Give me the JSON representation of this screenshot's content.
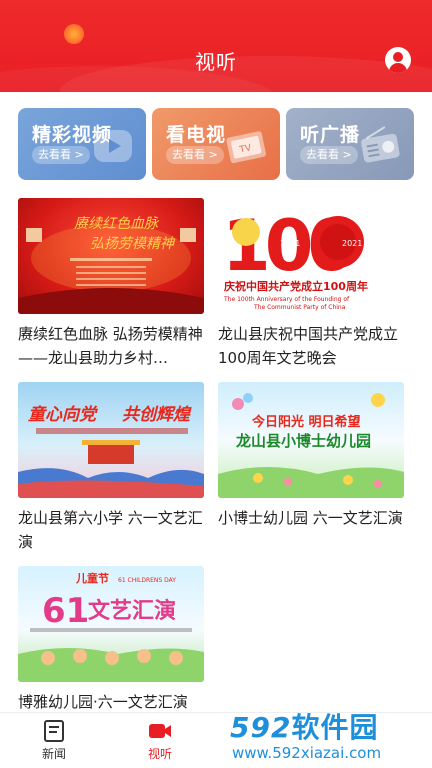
{
  "header": {
    "title": "视听"
  },
  "categories": [
    {
      "name": "精彩视频",
      "more": "去看看 >"
    },
    {
      "name": "看电视",
      "more": "去看看 >",
      "icon_text": "TV"
    },
    {
      "name": "听广播",
      "more": "去看看 >"
    }
  ],
  "videos": [
    {
      "caption": "赓续红色血脉 弘扬劳模精神 ——龙山县助力乡村…",
      "thumb_text": {
        "line1": "赓续红色血脉",
        "line2": "弘扬劳模精神"
      }
    },
    {
      "caption": "龙山县庆祝中国共产党成立100周年文艺晚会",
      "thumb_text": {
        "big": "100",
        "year_left": "1921",
        "year_right": "2021",
        "cn": "庆祝中国共产党成立100周年",
        "en1": "The 100th Anniversary of the Founding of",
        "en2": "The Communist Party of China"
      }
    },
    {
      "caption": "龙山县第六小学 六一文艺汇演",
      "thumb_text": {
        "line1": "童心向党",
        "line2": "共创辉煌"
      }
    },
    {
      "caption": "小博士幼儿园 六一文艺汇演",
      "thumb_text": {
        "line1": "今日阳光 明日希望",
        "line2": "龙山县小博士幼儿园"
      }
    },
    {
      "caption": "博雅幼儿园·六一文艺汇演",
      "thumb_text": {
        "line1": "儿童节",
        "line2": "61 CHILDRENS DAY",
        "line3": "文艺汇演"
      }
    }
  ],
  "tabbar": [
    {
      "label": "新闻",
      "active": false
    },
    {
      "label": "视听",
      "active": true
    }
  ],
  "watermark": {
    "logo_num": "592",
    "logo_cn": "软件园",
    "url": "www.592xiazai.com"
  },
  "colors": {
    "brand_red": "#e81e25",
    "watermark_blue": "#1e8fd8"
  }
}
